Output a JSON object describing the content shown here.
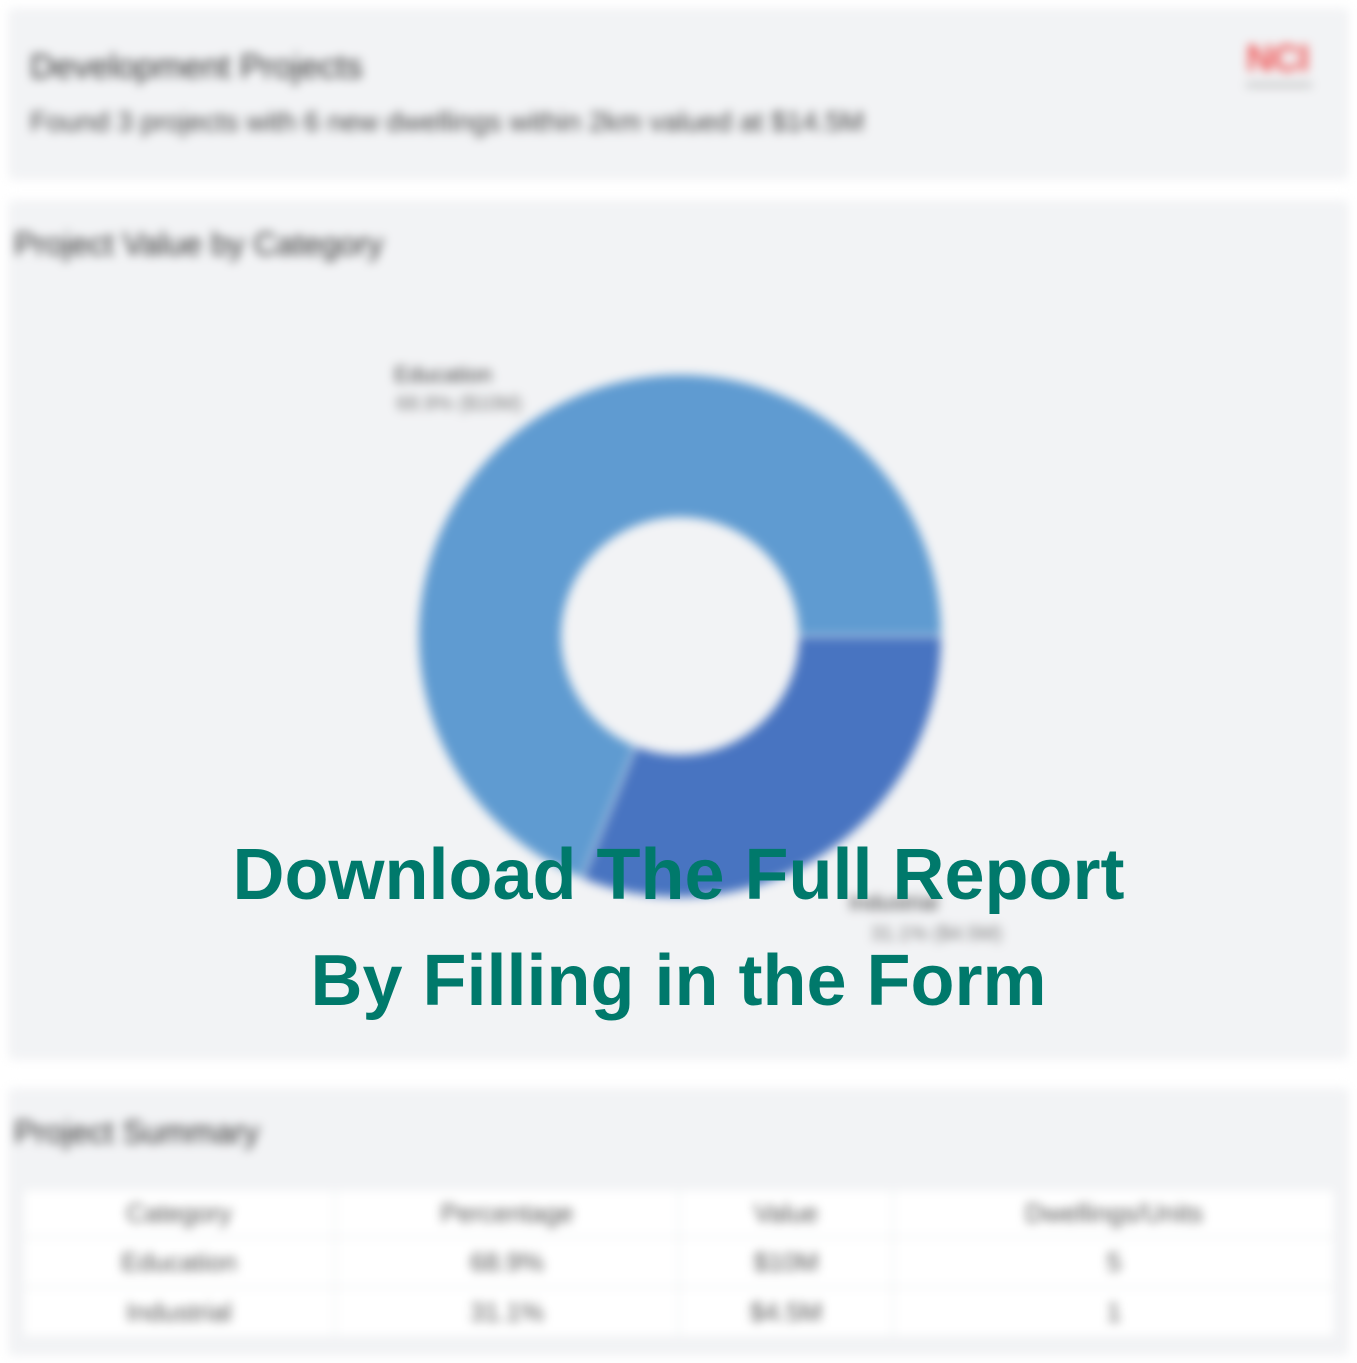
{
  "header": {
    "title": "Development Projects",
    "subtitle": "Found 3 projects with 6 new dwellings within 2km valued at $14.5M",
    "logo_text": "NCI"
  },
  "chart_section": {
    "title": "Project Value by Category"
  },
  "chart_data": {
    "type": "pie",
    "title": "Project Value by Category",
    "slices": [
      {
        "label": "Education",
        "percent": 68.9,
        "value": "$10M",
        "color": "#5f9bd1"
      },
      {
        "label": "Industrial",
        "percent": 31.1,
        "value": "$4.5M",
        "color": "#4874c1"
      }
    ],
    "slice_labels": [
      {
        "name": "Education",
        "detail": "68.9% ($10M)"
      },
      {
        "name": "Industrial",
        "detail": "31.1% ($4.5M)"
      }
    ]
  },
  "summary": {
    "title": "Project Summary",
    "columns": [
      "Category",
      "Percentage",
      "Value",
      "Dwellings/Units"
    ],
    "rows": [
      [
        "Education",
        "68.9%",
        "$10M",
        "5"
      ],
      [
        "Industrial",
        "31.1%",
        "$4.5M",
        "1"
      ]
    ]
  },
  "overlay": {
    "line1": "Download The Full Report",
    "line2": "By Filling in the Form"
  }
}
